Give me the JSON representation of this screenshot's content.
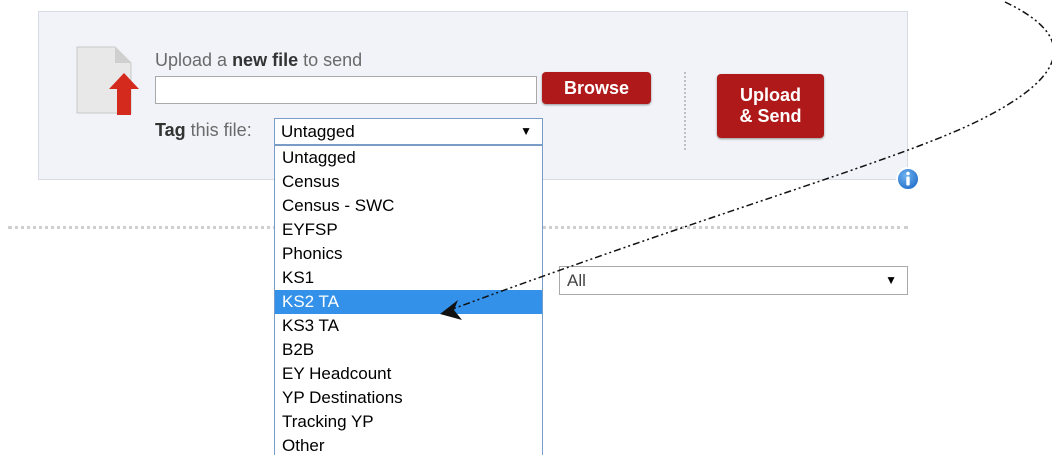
{
  "upload": {
    "prefix": "Upload a ",
    "bold": "new file",
    "suffix": " to send",
    "file_value": "",
    "browse_label": "Browse",
    "upload_send_label": "Upload\n& Send"
  },
  "tag": {
    "label_bold": "Tag",
    "label_rest": " this file:",
    "selected": "Untagged",
    "options": [
      "Untagged",
      "Census",
      "Census - SWC",
      "EYFSP",
      "Phonics",
      "KS1",
      "KS2 TA",
      "KS3 TA",
      "B2B",
      "EY Headcount",
      "YP Destinations",
      "Tracking YP",
      "Other"
    ],
    "highlighted_option": "KS2 TA"
  },
  "filter": {
    "selected": "All"
  },
  "icons": {
    "file_upload": "file-upload-icon",
    "info": "info-icon",
    "caret": "chevron-down-icon"
  },
  "colors": {
    "button_red": "#b01919",
    "highlight_blue": "#3391ea",
    "panel_bg": "#f1f3f8",
    "info_blue": "#2f7fd6"
  }
}
